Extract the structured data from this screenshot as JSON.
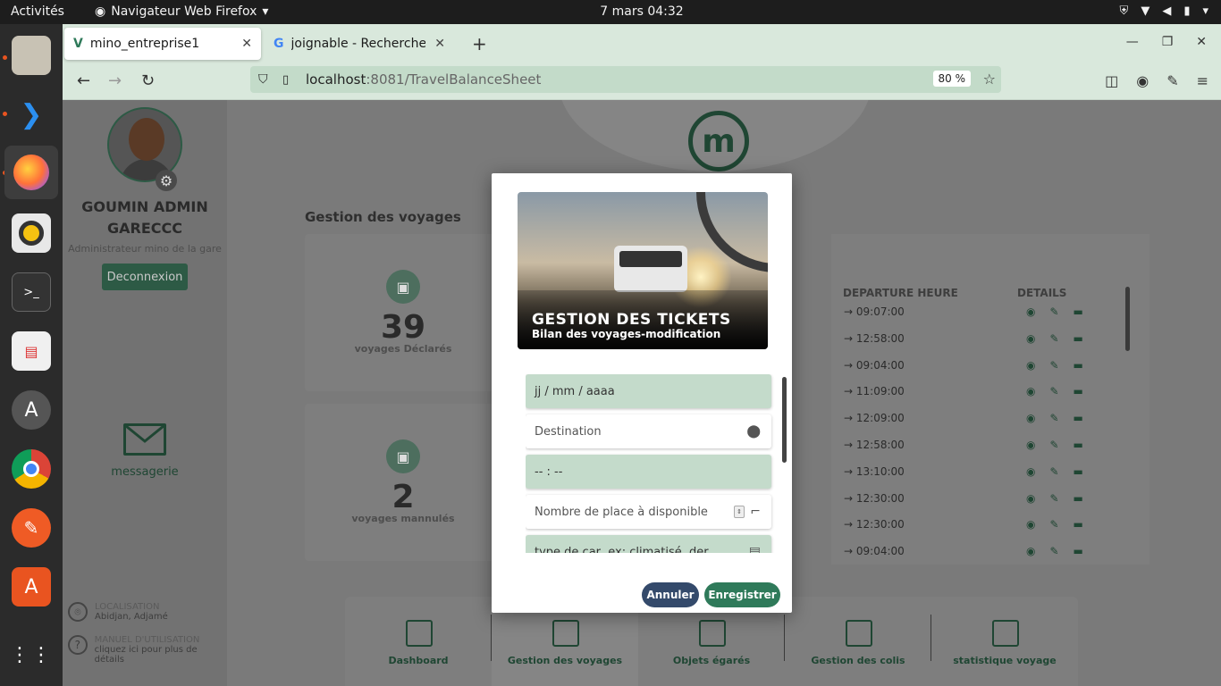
{
  "os": {
    "activities": "Activités",
    "app_name": "Navigateur Web Firefox",
    "clock": "7 mars  04:32"
  },
  "browser": {
    "tabs": [
      {
        "title": "mino_entreprise1"
      },
      {
        "title": "joignable - Recherche Go"
      }
    ],
    "url_host": "localhost",
    "url_path": ":8081/TravelBalanceSheet",
    "zoom": "80 %"
  },
  "sidebar": {
    "admin_name": "GOUMIN ADMIN GARECCC",
    "admin_role": "Administrateur mino de la gare",
    "logout": "Deconnexion",
    "messagerie": "messagerie",
    "location_label": "LOCALISATION",
    "location_value": "Abidjan, Adjamé",
    "manual_label": "MANUEL D'UTILISATION",
    "manual_value": "cliquez ici pour plus de détails"
  },
  "main": {
    "logo_letter": "m",
    "section_title": "Gestion des voyages",
    "stats": [
      {
        "value": "39",
        "label": "voyages Déclarés"
      },
      {
        "value": "2",
        "label": "voyages mannulés"
      }
    ],
    "table": {
      "headers": [
        "DEPARTURE HEURE",
        "DETAILS"
      ],
      "rows": [
        "09:07:00",
        "12:58:00",
        "09:04:00",
        "11:09:00",
        "12:09:00",
        "12:58:00",
        "13:10:00",
        "12:30:00",
        "12:30:00",
        "09:04:00"
      ]
    },
    "bottom_nav": [
      "Dashboard",
      "Gestion des voyages",
      "Objets égarés",
      "Gestion des colis",
      "statistique voyage"
    ]
  },
  "modal": {
    "hero_title": "GESTION DES TICKETS",
    "hero_subtitle": "Bilan des voyages-modification",
    "date_placeholder": "jj / mm / aaaa",
    "destination_placeholder": "Destination",
    "time_placeholder": "-- : --",
    "seats_placeholder": "Nombre de place à disponible",
    "car_type_placeholder": "type de car, ex: climatisé, der",
    "cancel": "Annuler",
    "save": "Enregistrer"
  }
}
